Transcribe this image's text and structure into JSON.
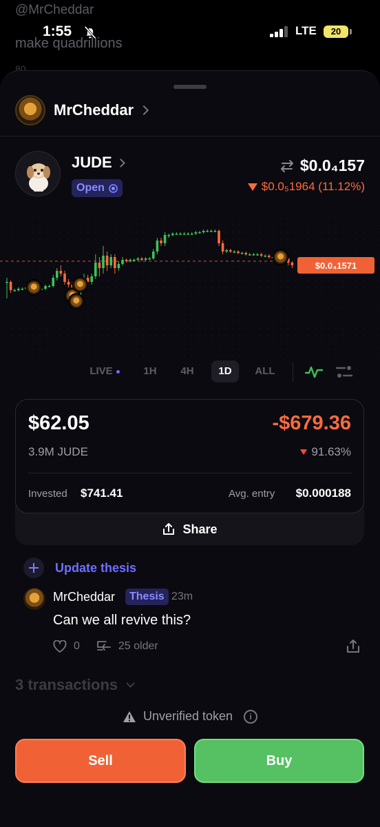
{
  "background": {
    "handle": "@MrCheddar",
    "subtitle": "make quadrillions",
    "ghost": "80"
  },
  "status_bar": {
    "time": "1:55",
    "network": "LTE",
    "battery": "20"
  },
  "creator": {
    "name": "MrCheddar"
  },
  "token": {
    "symbol": "JUDE",
    "status": "Open",
    "price": "$0.0₄157",
    "change": "$0.0₅1964 (11.12%)",
    "change_direction": "down"
  },
  "chart": {
    "current_price_label": "$0.0₄1571",
    "colors": {
      "up": "#3cc35a",
      "down": "#ff6a3d",
      "dashed": "#ff6a3d"
    },
    "reference_price_fraction": 0.67,
    "candles": [
      {
        "o": 0.52,
        "c": 0.52,
        "h": 0.4,
        "l": 0.55
      },
      {
        "o": 0.52,
        "c": 0.46,
        "h": 0.44,
        "l": 0.53
      },
      {
        "o": 0.46,
        "c": 0.46,
        "h": 0.45,
        "l": 0.47
      },
      {
        "o": 0.46,
        "c": 0.47,
        "h": 0.45,
        "l": 0.48
      },
      {
        "o": 0.47,
        "c": 0.47,
        "h": 0.46,
        "l": 0.48
      },
      {
        "o": 0.47,
        "c": 0.48,
        "h": 0.46,
        "l": 0.49
      },
      {
        "o": 0.48,
        "c": 0.48,
        "h": 0.47,
        "l": 0.49
      },
      {
        "o": 0.48,
        "c": 0.48,
        "h": 0.47,
        "l": 0.49
      },
      {
        "o": 0.48,
        "c": 0.47,
        "h": 0.46,
        "l": 0.49
      },
      {
        "o": 0.47,
        "c": 0.47,
        "h": 0.46,
        "l": 0.48
      },
      {
        "o": 0.47,
        "c": 0.49,
        "h": 0.46,
        "l": 0.5
      },
      {
        "o": 0.49,
        "c": 0.49,
        "h": 0.48,
        "l": 0.5
      },
      {
        "o": 0.49,
        "c": 0.55,
        "h": 0.48,
        "l": 0.57
      },
      {
        "o": 0.55,
        "c": 0.6,
        "h": 0.53,
        "l": 0.62
      },
      {
        "o": 0.6,
        "c": 0.58,
        "h": 0.56,
        "l": 0.64
      },
      {
        "o": 0.58,
        "c": 0.52,
        "h": 0.5,
        "l": 0.6
      },
      {
        "o": 0.52,
        "c": 0.5,
        "h": 0.48,
        "l": 0.54
      },
      {
        "o": 0.5,
        "c": 0.42,
        "h": 0.4,
        "l": 0.52
      },
      {
        "o": 0.42,
        "c": 0.38,
        "h": 0.36,
        "l": 0.46
      },
      {
        "o": 0.38,
        "c": 0.5,
        "h": 0.36,
        "l": 0.52
      },
      {
        "o": 0.5,
        "c": 0.55,
        "h": 0.48,
        "l": 0.58
      },
      {
        "o": 0.55,
        "c": 0.52,
        "h": 0.5,
        "l": 0.57
      },
      {
        "o": 0.52,
        "c": 0.56,
        "h": 0.5,
        "l": 0.58
      },
      {
        "o": 0.56,
        "c": 0.66,
        "h": 0.54,
        "l": 0.72
      },
      {
        "o": 0.66,
        "c": 0.62,
        "h": 0.56,
        "l": 0.7
      },
      {
        "o": 0.62,
        "c": 0.71,
        "h": 0.58,
        "l": 0.78
      },
      {
        "o": 0.71,
        "c": 0.64,
        "h": 0.6,
        "l": 0.74
      },
      {
        "o": 0.64,
        "c": 0.7,
        "h": 0.62,
        "l": 0.72
      },
      {
        "o": 0.7,
        "c": 0.62,
        "h": 0.58,
        "l": 0.72
      },
      {
        "o": 0.62,
        "c": 0.65,
        "h": 0.6,
        "l": 0.67
      },
      {
        "o": 0.65,
        "c": 0.68,
        "h": 0.64,
        "l": 0.7
      },
      {
        "o": 0.68,
        "c": 0.67,
        "h": 0.66,
        "l": 0.69
      },
      {
        "o": 0.67,
        "c": 0.68,
        "h": 0.66,
        "l": 0.69
      },
      {
        "o": 0.68,
        "c": 0.68,
        "h": 0.67,
        "l": 0.69
      },
      {
        "o": 0.68,
        "c": 0.69,
        "h": 0.67,
        "l": 0.7
      },
      {
        "o": 0.69,
        "c": 0.68,
        "h": 0.67,
        "l": 0.7
      },
      {
        "o": 0.68,
        "c": 0.69,
        "h": 0.67,
        "l": 0.7
      },
      {
        "o": 0.69,
        "c": 0.69,
        "h": 0.68,
        "l": 0.7
      },
      {
        "o": 0.69,
        "c": 0.74,
        "h": 0.68,
        "l": 0.76
      },
      {
        "o": 0.74,
        "c": 0.82,
        "h": 0.72,
        "l": 0.84
      },
      {
        "o": 0.82,
        "c": 0.8,
        "h": 0.78,
        "l": 0.84
      },
      {
        "o": 0.8,
        "c": 0.86,
        "h": 0.78,
        "l": 0.88
      },
      {
        "o": 0.86,
        "c": 0.86,
        "h": 0.84,
        "l": 0.87
      },
      {
        "o": 0.86,
        "c": 0.87,
        "h": 0.85,
        "l": 0.88
      },
      {
        "o": 0.87,
        "c": 0.87,
        "h": 0.86,
        "l": 0.88
      },
      {
        "o": 0.87,
        "c": 0.87,
        "h": 0.86,
        "l": 0.88
      },
      {
        "o": 0.87,
        "c": 0.87,
        "h": 0.86,
        "l": 0.88
      },
      {
        "o": 0.87,
        "c": 0.87,
        "h": 0.86,
        "l": 0.88
      },
      {
        "o": 0.87,
        "c": 0.87,
        "h": 0.86,
        "l": 0.88
      },
      {
        "o": 0.87,
        "c": 0.88,
        "h": 0.86,
        "l": 0.89
      },
      {
        "o": 0.88,
        "c": 0.88,
        "h": 0.87,
        "l": 0.89
      },
      {
        "o": 0.88,
        "c": 0.89,
        "h": 0.87,
        "l": 0.9
      },
      {
        "o": 0.89,
        "c": 0.89,
        "h": 0.88,
        "l": 0.9
      },
      {
        "o": 0.89,
        "c": 0.89,
        "h": 0.88,
        "l": 0.9
      },
      {
        "o": 0.89,
        "c": 0.89,
        "h": 0.88,
        "l": 0.9
      },
      {
        "o": 0.89,
        "c": 0.8,
        "h": 0.78,
        "l": 0.9
      },
      {
        "o": 0.8,
        "c": 0.74,
        "h": 0.72,
        "l": 0.82
      },
      {
        "o": 0.74,
        "c": 0.75,
        "h": 0.73,
        "l": 0.76
      },
      {
        "o": 0.75,
        "c": 0.74,
        "h": 0.73,
        "l": 0.76
      },
      {
        "o": 0.74,
        "c": 0.74,
        "h": 0.73,
        "l": 0.75
      },
      {
        "o": 0.74,
        "c": 0.73,
        "h": 0.72,
        "l": 0.75
      },
      {
        "o": 0.73,
        "c": 0.73,
        "h": 0.72,
        "l": 0.74
      },
      {
        "o": 0.73,
        "c": 0.72,
        "h": 0.71,
        "l": 0.74
      },
      {
        "o": 0.72,
        "c": 0.72,
        "h": 0.71,
        "l": 0.73
      },
      {
        "o": 0.72,
        "c": 0.72,
        "h": 0.71,
        "l": 0.73
      },
      {
        "o": 0.72,
        "c": 0.72,
        "h": 0.71,
        "l": 0.73
      },
      {
        "o": 0.72,
        "c": 0.71,
        "h": 0.7,
        "l": 0.73
      },
      {
        "o": 0.71,
        "c": 0.71,
        "h": 0.7,
        "l": 0.72
      },
      {
        "o": 0.71,
        "c": 0.7,
        "h": 0.69,
        "l": 0.72
      },
      {
        "o": 0.7,
        "c": 0.7,
        "h": 0.69,
        "l": 0.71
      },
      {
        "o": 0.7,
        "c": 0.7,
        "h": 0.69,
        "l": 0.71
      },
      {
        "o": 0.7,
        "c": 0.7,
        "h": 0.69,
        "l": 0.71
      },
      {
        "o": 0.7,
        "c": 0.69,
        "h": 0.68,
        "l": 0.71
      },
      {
        "o": 0.69,
        "c": 0.66,
        "h": 0.64,
        "l": 0.7
      },
      {
        "o": 0.66,
        "c": 0.64,
        "h": 0.62,
        "l": 0.67
      }
    ],
    "markers": [
      7,
      17,
      18,
      19,
      71
    ],
    "timeframes": [
      "LIVE",
      "1H",
      "4H",
      "1D",
      "ALL"
    ],
    "active_timeframe": "1D"
  },
  "position": {
    "value": "$62.05",
    "pnl": "-$679.36",
    "quantity": "3.9M JUDE",
    "pnl_percent": "91.63%",
    "invested_label": "Invested",
    "invested_value": "$741.41",
    "avg_entry_label": "Avg. entry",
    "avg_entry_value": "$0.000188",
    "share_label": "Share"
  },
  "thesis": {
    "update_label": "Update thesis"
  },
  "post": {
    "author": "MrCheddar",
    "badge": "Thesis",
    "time": "23m",
    "text": "Can we all revive this?",
    "likes": "0",
    "older": "25 older"
  },
  "transactions": {
    "label": "3 transactions"
  },
  "warning": {
    "label": "Unverified token",
    "info_glyph": "i"
  },
  "actions": {
    "sell": "Sell",
    "buy": "Buy"
  }
}
